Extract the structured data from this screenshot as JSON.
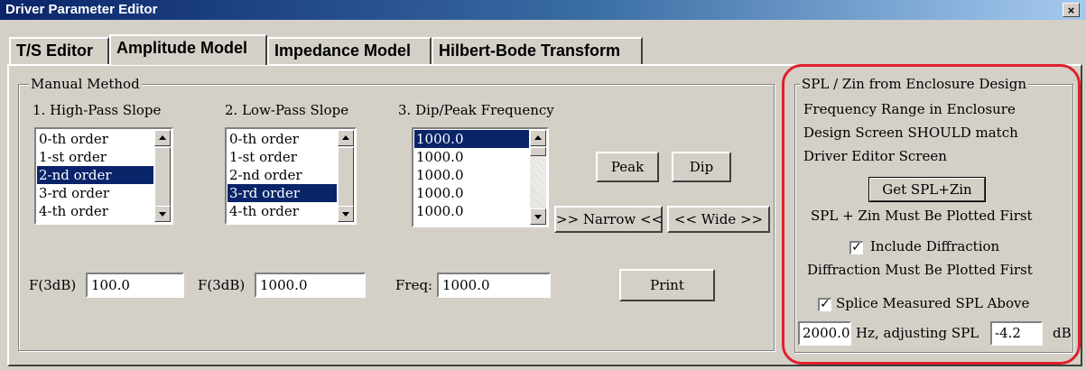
{
  "window": {
    "title": "Driver Parameter Editor",
    "close_glyph": "×"
  },
  "tabs": [
    {
      "label": "T/S Editor"
    },
    {
      "label": "Amplitude Model"
    },
    {
      "label": "Impedance Model"
    },
    {
      "label": "Hilbert-Bode Transform"
    }
  ],
  "manual": {
    "legend": "Manual Method",
    "hp": {
      "label": "1. High-Pass Slope",
      "items": [
        "0-th order",
        "1-st order",
        "2-nd order",
        "3-rd order",
        "4-th order"
      ],
      "fdb_label": "F(3dB)",
      "fdb_value": "100.0"
    },
    "lp": {
      "label": "2. Low-Pass Slope",
      "items": [
        "0-th order",
        "1-st order",
        "2-nd order",
        "3-rd order",
        "4-th order"
      ],
      "fdb_label": "F(3dB)",
      "fdb_value": "1000.0"
    },
    "dip": {
      "label": "3. Dip/Peak Frequency",
      "items": [
        "1000.0",
        "1000.0",
        "1000.0",
        "1000.0",
        "1000.0"
      ],
      "freq_label": "Freq:",
      "freq_value": "1000.0"
    },
    "buttons": {
      "peak": "Peak",
      "dip": "Dip",
      "narrow": ">> Narrow <<",
      "wide": "<< Wide >>",
      "print": "Print"
    }
  },
  "spl": {
    "legend": "SPL / Zin from Enclosure Design",
    "note1": "Frequency Range in Enclosure",
    "note2": "Design Screen SHOULD match",
    "note3": "Driver Editor Screen",
    "get_button": "Get SPL+Zin",
    "must_plot": "SPL + Zin Must Be Plotted First",
    "include_diffraction": "Include Diffraction",
    "diffraction_note": "Diffraction Must Be Plotted First",
    "splice": "Splice Measured SPL Above",
    "splice_freq": "2000.0",
    "hz_label": "Hz, adjusting SPL",
    "adjust_value": "-4.2",
    "db_label": "dB",
    "check_glyph": "✓"
  },
  "colors": {
    "highlight": "#e0202a",
    "selection": "#0a246a",
    "titlebar": "#0a246a"
  }
}
